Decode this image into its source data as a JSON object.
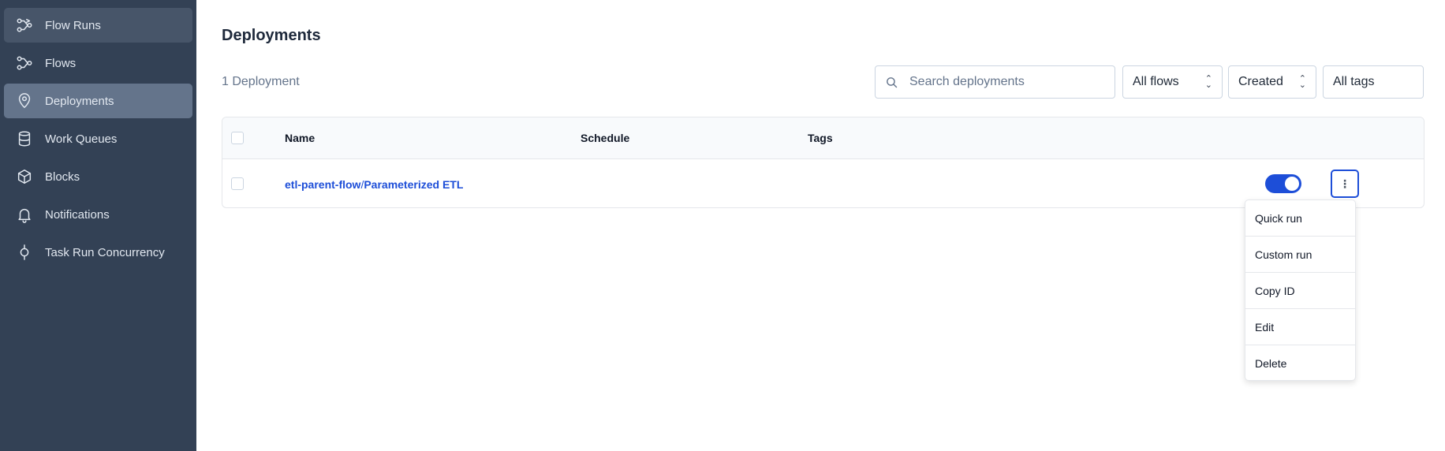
{
  "sidebar": {
    "items": [
      {
        "label": "Flow Runs",
        "icon": "flow-runs-icon"
      },
      {
        "label": "Flows",
        "icon": "flows-icon"
      },
      {
        "label": "Deployments",
        "icon": "location-pin-icon"
      },
      {
        "label": "Work Queues",
        "icon": "database-icon"
      },
      {
        "label": "Blocks",
        "icon": "cube-icon"
      },
      {
        "label": "Notifications",
        "icon": "bell-icon"
      },
      {
        "label": "Task Run Concurrency",
        "icon": "concurrency-icon"
      }
    ]
  },
  "page": {
    "title": "Deployments",
    "count": "1 Deployment"
  },
  "filters": {
    "search_placeholder": "Search deployments",
    "flows": "All flows",
    "sort": "Created",
    "tags": "All tags"
  },
  "table": {
    "headers": [
      "Name",
      "Schedule",
      "Tags"
    ],
    "rows": [
      {
        "flow": "etl-parent-flow",
        "separator": "/",
        "deployment": "Parameterized ETL",
        "schedule": "",
        "tags": "",
        "active": true
      }
    ]
  },
  "menu": {
    "items": [
      "Quick run",
      "Custom run",
      "Copy ID",
      "Edit",
      "Delete"
    ]
  },
  "colors": {
    "sidebar_bg": "#334155",
    "accent": "#1d4ed8"
  }
}
